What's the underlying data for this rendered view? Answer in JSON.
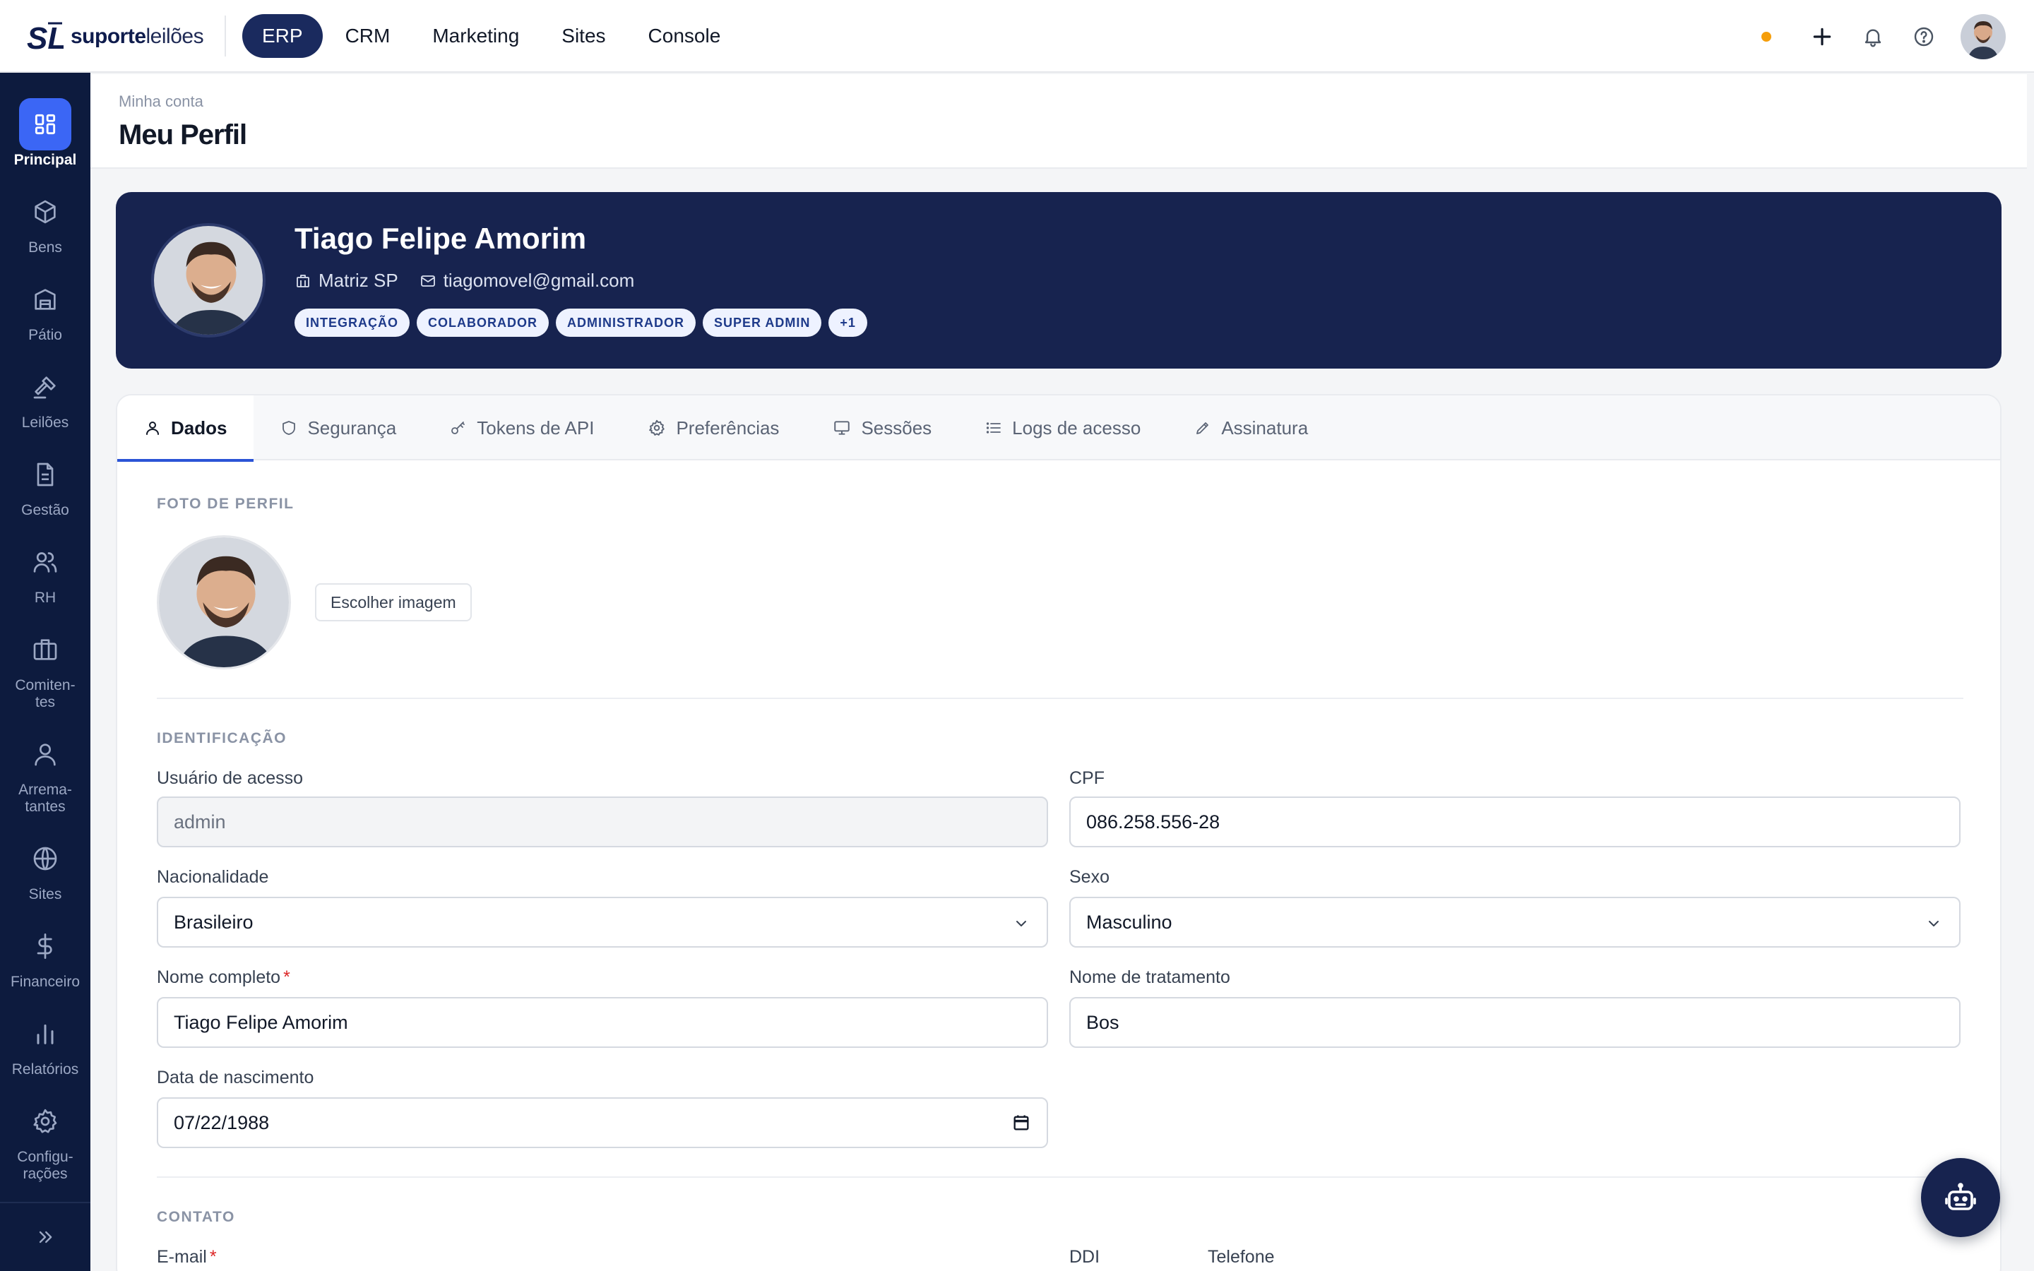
{
  "app": {
    "brand_bold": "suporte",
    "brand_light": "leilões",
    "logo_mark": "SL"
  },
  "topnav": {
    "items": [
      {
        "label": "ERP",
        "active": true
      },
      {
        "label": "CRM"
      },
      {
        "label": "Marketing"
      },
      {
        "label": "Sites"
      },
      {
        "label": "Console"
      }
    ]
  },
  "top_actions": {
    "status_color": "#f59e0b",
    "icons": [
      "plus-icon",
      "bell-icon",
      "help-icon"
    ]
  },
  "sidebar": {
    "items": [
      {
        "label": "Principal",
        "icon": "grid-icon",
        "active": true
      },
      {
        "label": "Bens",
        "icon": "box-icon"
      },
      {
        "label": "Pátio",
        "icon": "warehouse-icon"
      },
      {
        "label": "Leilões",
        "icon": "gavel-icon"
      },
      {
        "label": "Gestão",
        "icon": "document-icon"
      },
      {
        "label": "RH",
        "icon": "users-icon"
      },
      {
        "label": "Comiten-\ntes",
        "icon": "briefcase-icon"
      },
      {
        "label": "Arrema-\ntantes",
        "icon": "user-icon"
      },
      {
        "label": "Sites",
        "icon": "globe-icon"
      },
      {
        "label": "Financeiro",
        "icon": "dollar-icon"
      },
      {
        "label": "Relatórios",
        "icon": "bar-chart-icon"
      },
      {
        "label": "Configu-\nrações",
        "icon": "gear-icon"
      }
    ]
  },
  "page": {
    "breadcrumb": "Minha conta",
    "title": "Meu Perfil"
  },
  "profile": {
    "name": "Tiago Felipe Amorim",
    "branch": "Matriz SP",
    "email": "tiagomovel@gmail.com",
    "tags": [
      "INTEGRAÇÃO",
      "COLABORADOR",
      "ADMINISTRADOR",
      "SUPER ADMIN",
      "+1"
    ]
  },
  "tabs": [
    {
      "label": "Dados",
      "icon": "user-icon",
      "active": true
    },
    {
      "label": "Segurança",
      "icon": "shield-icon"
    },
    {
      "label": "Tokens de API",
      "icon": "key-icon"
    },
    {
      "label": "Preferências",
      "icon": "gear-icon"
    },
    {
      "label": "Sessões",
      "icon": "monitor-icon"
    },
    {
      "label": "Logs de acesso",
      "icon": "list-icon"
    },
    {
      "label": "Assinatura",
      "icon": "pen-icon"
    }
  ],
  "form": {
    "photo_section": "FOTO DE PERFIL",
    "choose_image": "Escolher imagem",
    "ident_section": "IDENTIFICAÇÃO",
    "contact_section": "CONTATO",
    "fields": {
      "username": {
        "label": "Usuário de acesso",
        "value": "admin"
      },
      "cpf": {
        "label": "CPF",
        "value": "086.258.556-28"
      },
      "nationality": {
        "label": "Nacionalidade",
        "value": "Brasileiro"
      },
      "sex": {
        "label": "Sexo",
        "value": "Masculino"
      },
      "full_name": {
        "label": "Nome completo",
        "value": "Tiago Felipe Amorim",
        "required": "*"
      },
      "nickname": {
        "label": "Nome de tratamento",
        "value": "Bos"
      },
      "birthdate": {
        "label": "Data de nascimento",
        "value": "07/22/1988"
      },
      "email": {
        "label": "E-mail",
        "required": "*"
      },
      "ddi": {
        "label": "DDI"
      },
      "phone": {
        "label": "Telefone"
      }
    }
  },
  "colors": {
    "navy": "#17234f",
    "sidebar": "#0d1b3e",
    "accent": "#3b66f5"
  }
}
